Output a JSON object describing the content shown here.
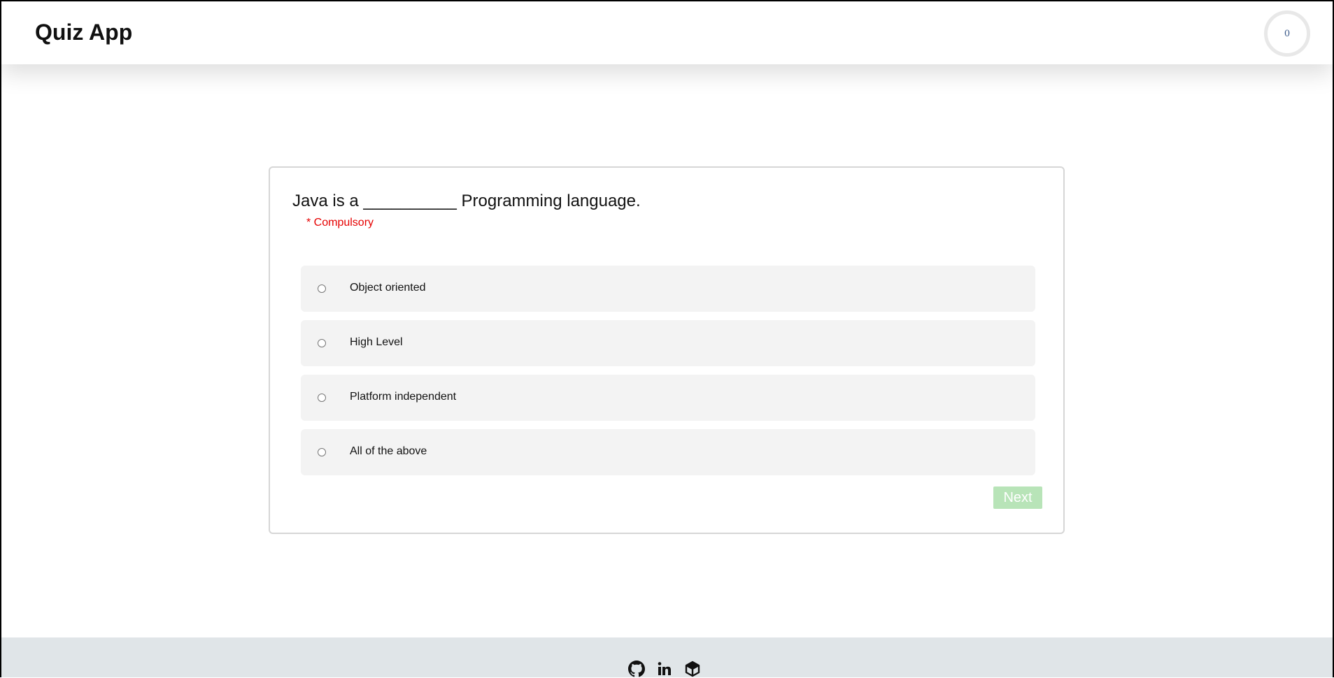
{
  "header": {
    "title": "Quiz App",
    "timer_value": "0"
  },
  "quiz": {
    "question": "Java is a __________ Programming language.",
    "required_note": "* Compulsory",
    "options": [
      {
        "label": "Object oriented",
        "selected": false
      },
      {
        "label": "High Level",
        "selected": false
      },
      {
        "label": "Platform independent",
        "selected": false
      },
      {
        "label": "All of the above",
        "selected": false
      }
    ],
    "next_label": "Next"
  },
  "footer": {
    "icons": [
      "github-icon",
      "linkedin-icon",
      "codesandbox-icon"
    ]
  },
  "colors": {
    "required_text": "#e60000",
    "next_button_disabled": "#b8e4b8",
    "option_background": "#f3f3f3",
    "footer_background": "#e0e5e8"
  }
}
